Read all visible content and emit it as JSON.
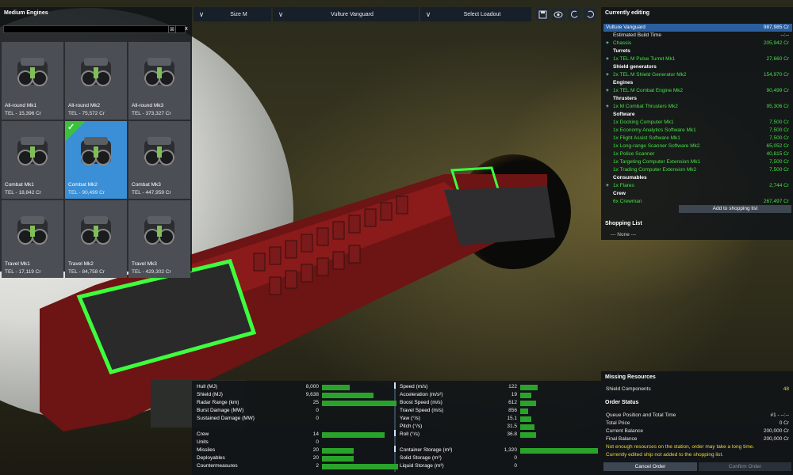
{
  "engines_panel": {
    "title": "Medium Engines",
    "search_value": "",
    "clear_glyph": "⊠",
    "close_glyph": "x",
    "items": [
      {
        "name": "All-round Mk1",
        "price": "TEL - 15,396 Cr",
        "selected": false
      },
      {
        "name": "All-round Mk2",
        "price": "TEL - 75,572 Cr",
        "selected": false
      },
      {
        "name": "All-round Mk3",
        "price": "TEL - 373,327 Cr",
        "selected": false
      },
      {
        "name": "Combat Mk1",
        "price": "TEL - 18,842 Cr",
        "selected": false
      },
      {
        "name": "Combat Mk2",
        "price": "TEL - 90,499 Cr",
        "selected": true
      },
      {
        "name": "Combat Mk3",
        "price": "TEL - 447,959 Cr",
        "selected": false
      },
      {
        "name": "Travel Mk1",
        "price": "TEL - 17,119 Cr",
        "selected": false
      },
      {
        "name": "Travel Mk2",
        "price": "TEL - 84,758 Cr",
        "selected": false
      },
      {
        "name": "Travel Mk3",
        "price": "TEL - 429,302 Cr",
        "selected": false
      }
    ]
  },
  "topbar": {
    "size_label": "Size M",
    "ship_label": "Vulture Vanguard",
    "loadout_label": "Select Loadout",
    "chevron": "∨"
  },
  "toolbar_icons": [
    "save-icon",
    "eye-icon",
    "undo-icon",
    "redo-icon"
  ],
  "editing": {
    "title": "Currently editing",
    "ship_name": "Vulture Vanguard",
    "ship_price": "987,985 Cr",
    "build_time_label": "Estimated Build Time",
    "build_time_value": "--:--",
    "chassis_label": "Chassis",
    "chassis_price": "205,942 Cr",
    "sections": [
      {
        "header": "Turrets",
        "items": [
          {
            "label": "1x TEL M Pulse Turret Mk1",
            "price": "27,660 Cr",
            "plus": true
          }
        ]
      },
      {
        "header": "Shield generators",
        "items": [
          {
            "label": "2x TEL M Shield Generator Mk2",
            "price": "154,970 Cr",
            "plus": true
          }
        ]
      },
      {
        "header": "Engines",
        "items": [
          {
            "label": "1x TEL M Combat Engine Mk2",
            "price": "90,499 Cr",
            "plus": true
          }
        ]
      },
      {
        "header": "Thrusters",
        "items": [
          {
            "label": "1x M Combat Thrusters Mk2",
            "price": "95,306 Cr",
            "plus": true
          }
        ]
      },
      {
        "header": "Software",
        "items": [
          {
            "label": "1x Docking Computer Mk1",
            "price": "7,500 Cr",
            "plus": false
          },
          {
            "label": "1x Economy Analytics Software Mk1",
            "price": "7,500 Cr",
            "plus": false
          },
          {
            "label": "1x Flight Assist Software Mk1",
            "price": "7,500 Cr",
            "plus": false
          },
          {
            "label": "1x Long-range Scanner Software Mk2",
            "price": "65,052 Cr",
            "plus": false
          },
          {
            "label": "1x Police Scanner",
            "price": "40,815 Cr",
            "plus": false
          },
          {
            "label": "1x Targeting Computer Extension Mk1",
            "price": "7,500 Cr",
            "plus": false
          },
          {
            "label": "1x Trading Computer Extension Mk2",
            "price": "7,500 Cr",
            "plus": false
          }
        ]
      },
      {
        "header": "Consumables",
        "items": [
          {
            "label": "1x Flares",
            "price": "2,744 Cr",
            "plus": true
          }
        ]
      },
      {
        "header": "Crew",
        "items": [
          {
            "label": "6x Crewman",
            "price": "267,497 Cr",
            "plus": false
          }
        ]
      }
    ],
    "add_to_shopping": "Add to shopping list",
    "shopping_title": "Shopping List",
    "shopping_none": "--- None ---"
  },
  "stats": {
    "col1": [
      {
        "name": "Hull (MJ)",
        "value": "8,000",
        "fill": 0.36
      },
      {
        "name": "Shield (MJ)",
        "value": "9,638",
        "fill": 0.68
      },
      {
        "name": "Radar Range (km)",
        "value": "25",
        "fill": 0.98
      },
      {
        "name": "Burst Damage (MW)",
        "value": "0",
        "fill": 0
      },
      {
        "name": "Sustained Damage (MW)",
        "value": "0",
        "fill": 0
      },
      {
        "name": "",
        "value": "",
        "fill": 0
      },
      {
        "name": "Crew",
        "value": "14",
        "fill": 0.82
      },
      {
        "name": "Units",
        "value": "0",
        "fill": 0
      },
      {
        "name": "Missiles",
        "value": "20",
        "fill": 0.42
      },
      {
        "name": "Deployables",
        "value": "20",
        "fill": 0.42
      },
      {
        "name": "Countermeasures",
        "value": "2",
        "fill": 1.0
      }
    ],
    "col2": [
      {
        "name": "Speed (m/s)",
        "value": "122",
        "fill": 0.22
      },
      {
        "name": "Acceleration (m/s²)",
        "value": "19",
        "fill": 0.14
      },
      {
        "name": "Boost Speed (m/s)",
        "value": "612",
        "fill": 0.2
      },
      {
        "name": "Travel Speed (m/s)",
        "value": "856",
        "fill": 0.1
      },
      {
        "name": "Yaw (°/s)",
        "value": "15.1",
        "fill": 0.14
      },
      {
        "name": "Pitch (°/s)",
        "value": "31.5",
        "fill": 0.18
      },
      {
        "name": "Roll (°/s)",
        "value": "36.8",
        "fill": 0.2
      },
      {
        "name": "",
        "value": "",
        "fill": 0
      },
      {
        "name": "Container Storage (m³)",
        "value": "1,320",
        "fill": 0.98
      },
      {
        "name": "Solid Storage (m³)",
        "value": "0",
        "fill": 0
      },
      {
        "name": "Liquid Storage (m³)",
        "value": "0",
        "fill": 0
      }
    ]
  },
  "resources": {
    "missing_title": "Missing Resources",
    "shield_components_label": "Shield Components",
    "shield_components_value": "48",
    "order_title": "Order Status",
    "queue_label": "Queue Position and Total Time",
    "queue_value": "#1 - --:--",
    "total_price_label": "Total Price",
    "total_price_value": "0 Cr",
    "current_balance_label": "Current Balance",
    "current_balance_value": "200,000 Cr",
    "final_balance_label": "Final Balance",
    "final_balance_value": "200,000 Cr",
    "warning1": "Not enough resources on the station, order may take a long time.",
    "warning2": "Currently edited ship not added to the shopping list.",
    "cancel_label": "Cancel Order",
    "confirm_label": "Confirm Order"
  },
  "colors": {
    "accent": "#3a8fd6",
    "ok": "#45e045",
    "warn": "#f2d43a",
    "bar": "#2aa32a"
  }
}
